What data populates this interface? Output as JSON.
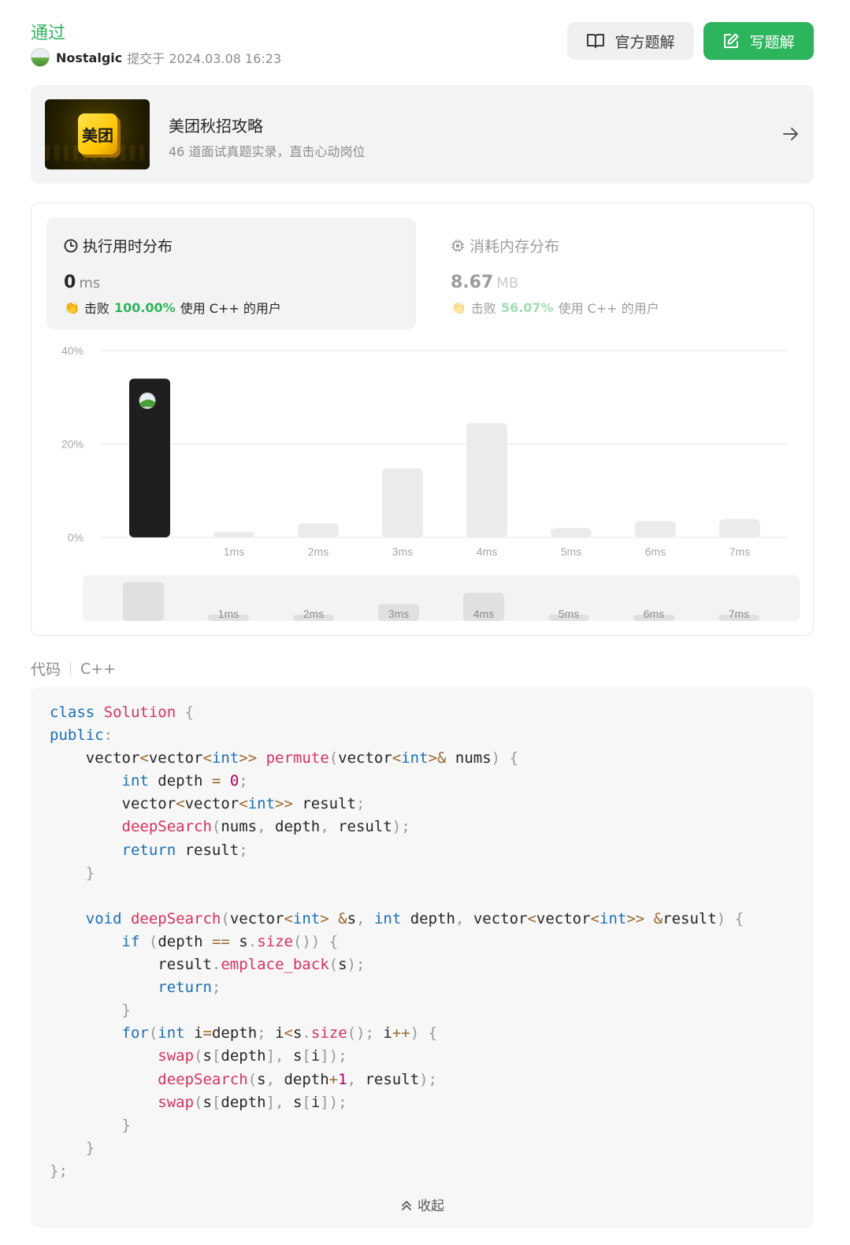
{
  "header": {
    "status": "通过",
    "user_name": "Nostalgic",
    "submitted_at": "提交于 2024.03.08 16:23",
    "btn_official": "官方题解",
    "btn_write": "写题解"
  },
  "promo": {
    "logo_text": "美团",
    "title": "美团秋招攻略",
    "subtitle": "46 道面试真题实录，直击心动岗位"
  },
  "runtime": {
    "heading": "执行用时分布",
    "value": "0",
    "unit": "ms",
    "beat_prefix": "击败",
    "beat_pct": "100.00%",
    "beat_suffix": "使用 C++ 的用户"
  },
  "memory": {
    "heading": "消耗内存分布",
    "value": "8.67",
    "unit": "MB",
    "beat_prefix": "击败",
    "beat_pct": "56.07%",
    "beat_suffix": "使用 C++ 的用户"
  },
  "chart_data": {
    "type": "bar",
    "categories": [
      "",
      "1ms",
      "2ms",
      "3ms",
      "4ms",
      "5ms",
      "6ms",
      "7ms"
    ],
    "values": [
      34,
      1.2,
      3,
      14.8,
      24.5,
      2,
      3.5,
      3.9
    ],
    "highlight_index": 0,
    "y_ticks": [
      "40%",
      "20%",
      "0%"
    ],
    "ylim": [
      0,
      40
    ],
    "grid": true,
    "colors": {
      "highlight": "#1f1f1f",
      "bar": "#ebebeb",
      "grid": "#e6e6e6",
      "tick": "#a6a6a6"
    }
  },
  "code": {
    "label": "代码",
    "language": "C++",
    "collapse_label": "收起"
  },
  "colors": {
    "accent": "#2db55d",
    "card_bg": "#f3f3f3"
  }
}
